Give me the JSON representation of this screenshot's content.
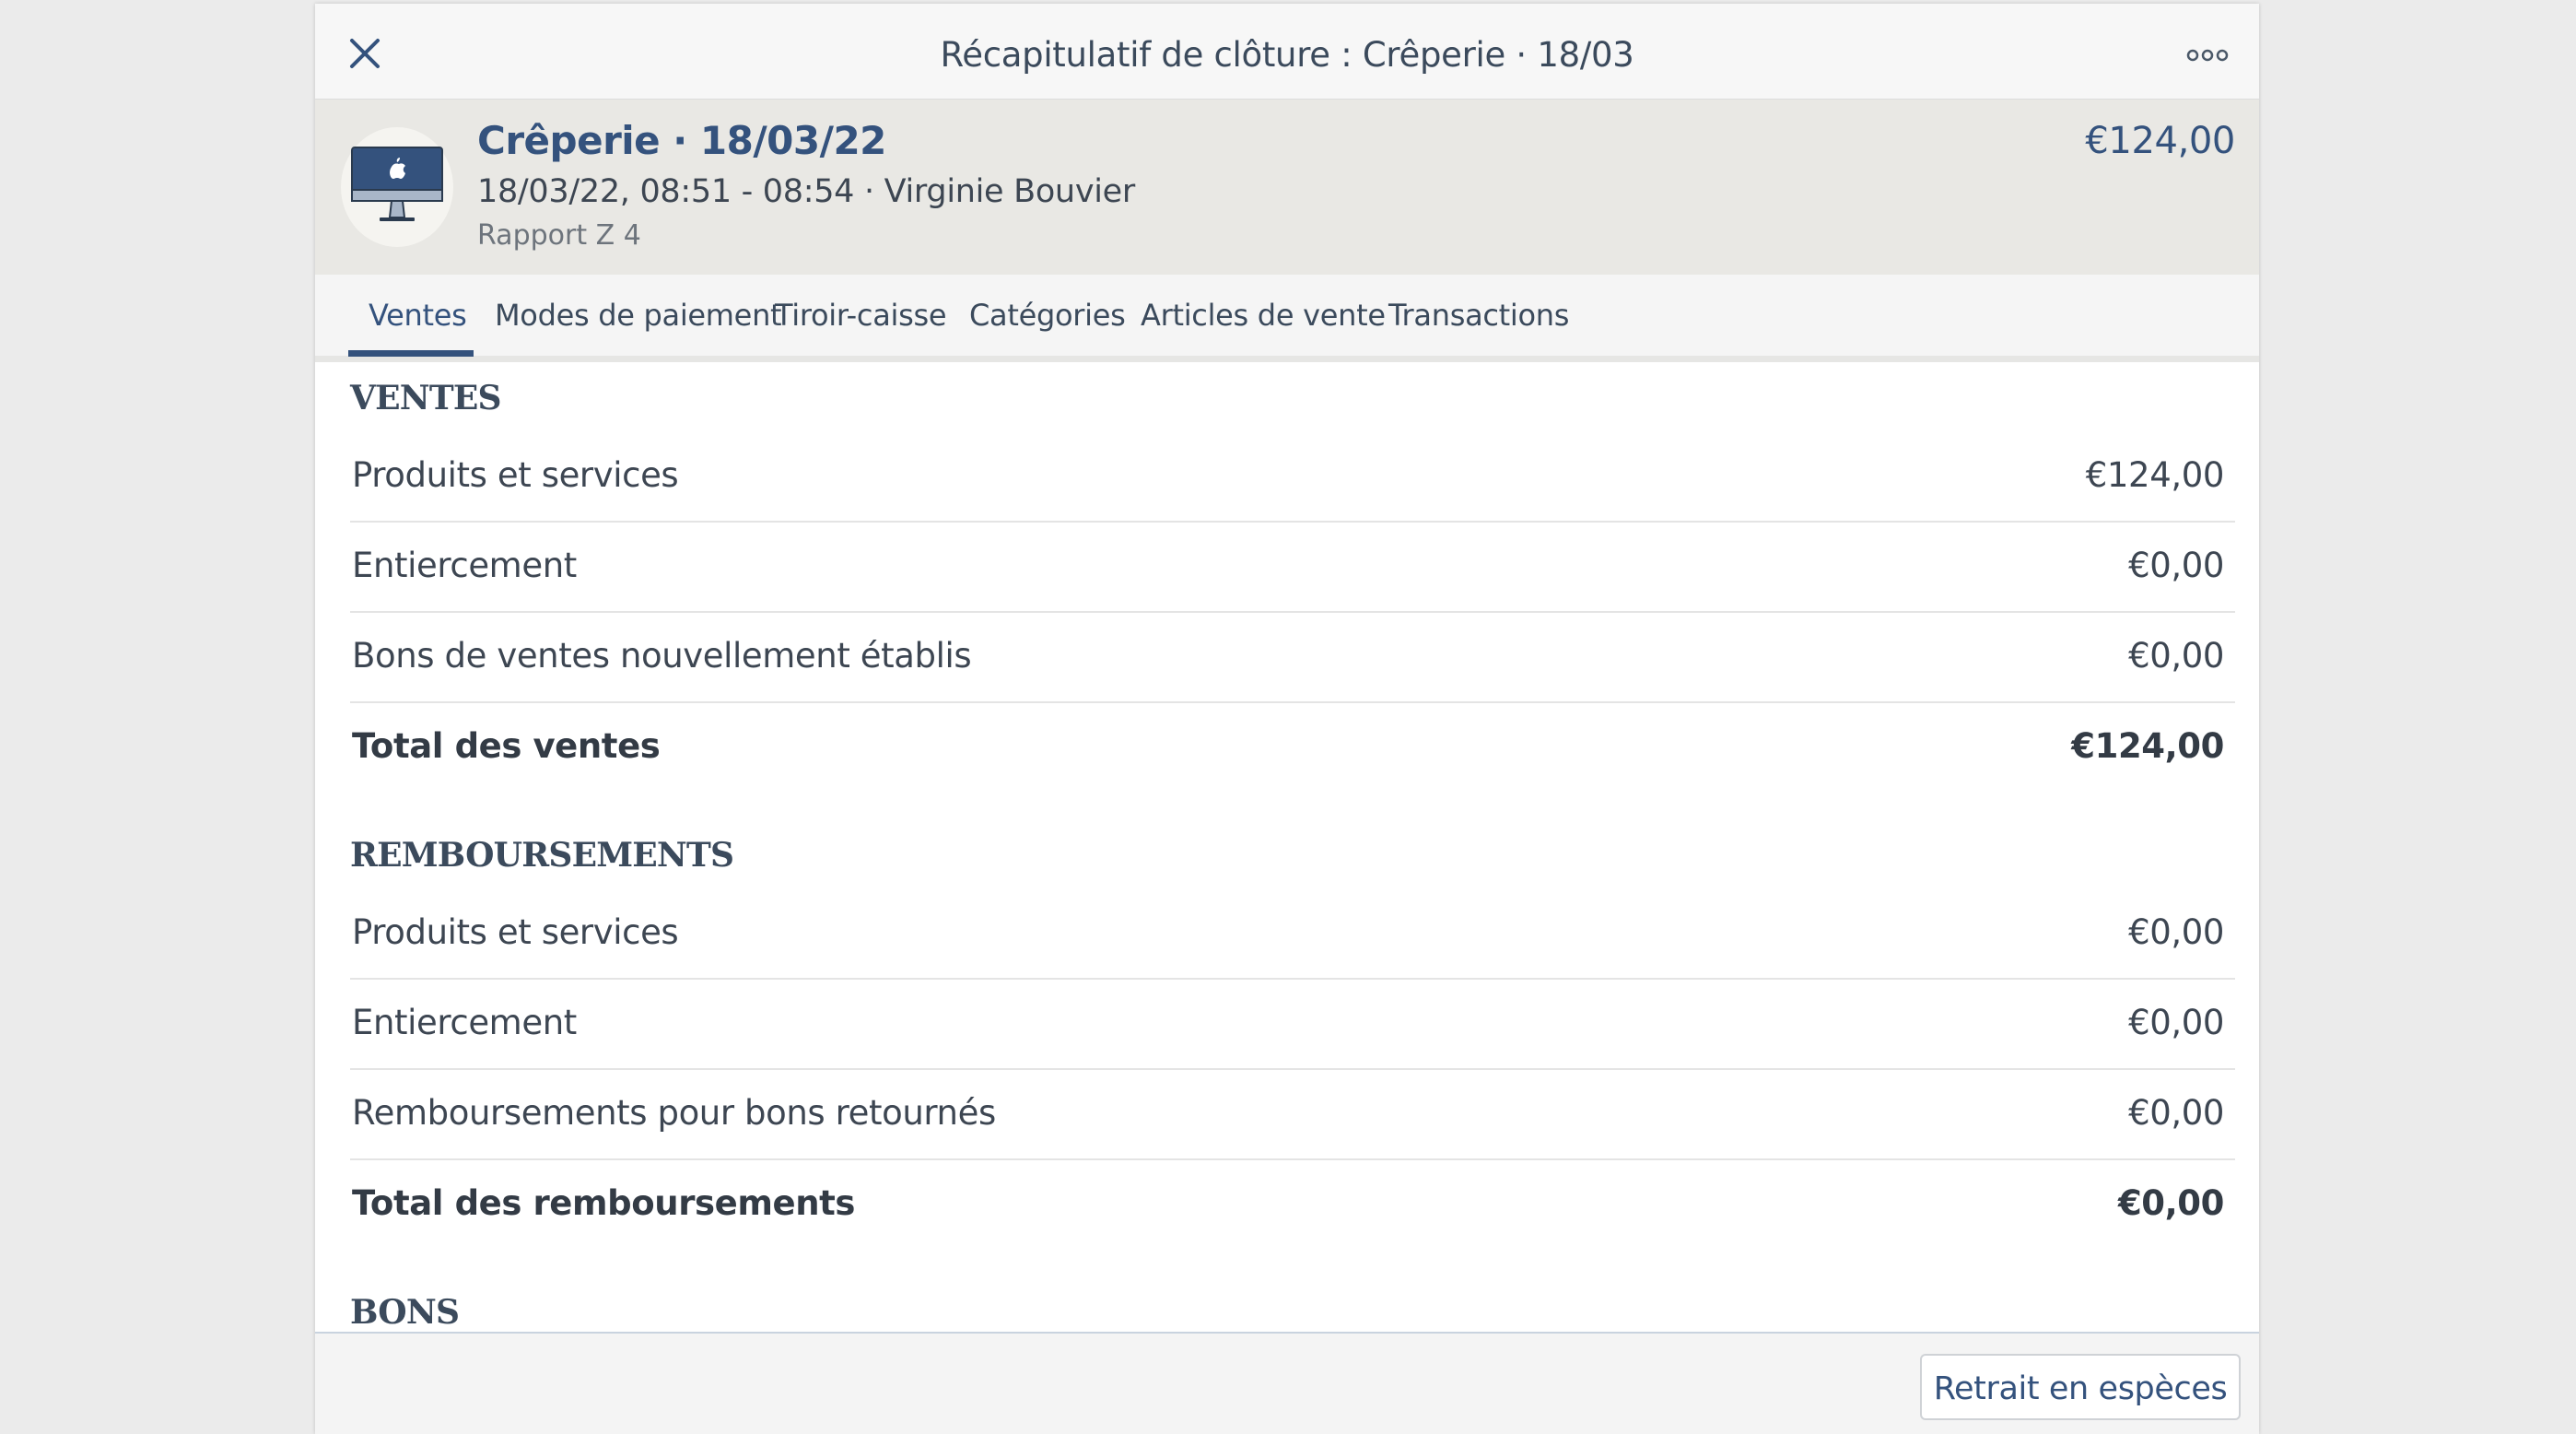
{
  "titlebar": {
    "title": "Récapitulatif de clôture : Crêperie · 18/03",
    "close_icon": "close-icon",
    "more_icon": "more-horizontal-icon"
  },
  "summary": {
    "device_icon": "imac-icon",
    "title": "Crêperie · 18/03/22",
    "subtitle": "18/03/22, 08:51 - 08:54 · Virginie Bouvier",
    "report": "Rapport Z 4",
    "amount": "€124,00"
  },
  "tabs": [
    {
      "label": "Ventes",
      "active": true
    },
    {
      "label": "Modes de paiement",
      "active": false
    },
    {
      "label": "Tiroir-caisse",
      "active": false
    },
    {
      "label": "Catégories",
      "active": false
    },
    {
      "label": "Articles de vente",
      "active": false
    },
    {
      "label": "Transactions",
      "active": false
    }
  ],
  "sections": {
    "ventes": {
      "title": "VENTES",
      "rows": [
        {
          "label": "Produits et services",
          "value": "€124,00"
        },
        {
          "label": "Entiercement",
          "value": "€0,00"
        },
        {
          "label": "Bons de ventes nouvellement établis",
          "value": "€0,00"
        },
        {
          "label": "Total des ventes",
          "value": "€124,00"
        }
      ]
    },
    "remboursements": {
      "title": "REMBOURSEMENTS",
      "rows": [
        {
          "label": "Produits et services",
          "value": "€0,00"
        },
        {
          "label": "Entiercement",
          "value": "€0,00"
        },
        {
          "label": "Remboursements pour bons retournés",
          "value": "€0,00"
        },
        {
          "label": "Total des remboursements",
          "value": "€0,00"
        }
      ]
    },
    "bons": {
      "title": "BONS"
    }
  },
  "footer": {
    "cash_withdrawal_label": "Retrait en espèces"
  },
  "colors": {
    "accent": "#34527d",
    "header_bg": "#e9e8e4",
    "page_bg": "#ebebeb"
  }
}
